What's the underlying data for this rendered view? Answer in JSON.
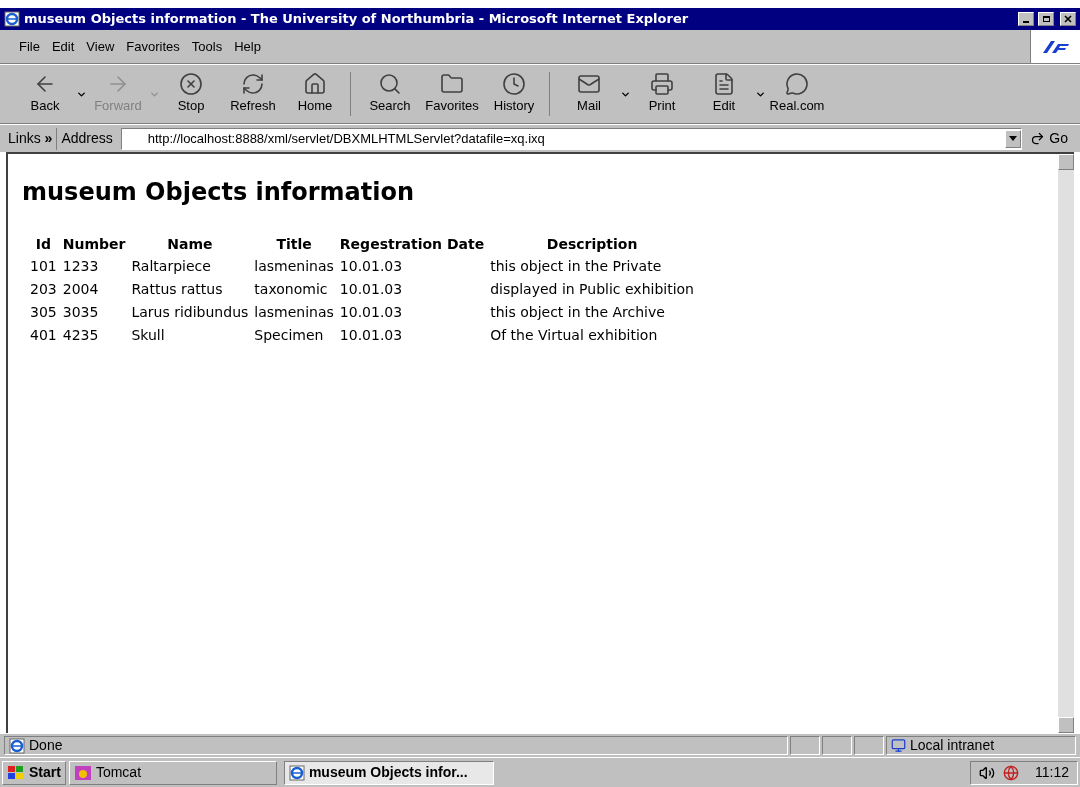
{
  "window": {
    "title": "museum Objects information - The University of Northumbria - Microsoft Internet Explorer"
  },
  "menu": [
    {
      "label": "File"
    },
    {
      "label": "Edit"
    },
    {
      "label": "View"
    },
    {
      "label": "Favorites"
    },
    {
      "label": "Tools"
    },
    {
      "label": "Help"
    }
  ],
  "toolbar": {
    "groups": [
      [
        {
          "label": "Back",
          "disabled": false,
          "dropdown": true
        },
        {
          "label": "Forward",
          "disabled": true,
          "dropdown": true
        },
        {
          "label": "Stop",
          "disabled": false,
          "dropdown": false
        },
        {
          "label": "Refresh",
          "disabled": false,
          "dropdown": false
        },
        {
          "label": "Home",
          "disabled": false,
          "dropdown": false
        }
      ],
      [
        {
          "label": "Search",
          "disabled": false,
          "dropdown": false
        },
        {
          "label": "Favorites",
          "disabled": false,
          "dropdown": false
        },
        {
          "label": "History",
          "disabled": false,
          "dropdown": false
        }
      ],
      [
        {
          "label": "Mail",
          "disabled": false,
          "dropdown": true
        },
        {
          "label": "Print",
          "disabled": false,
          "dropdown": false
        },
        {
          "label": "Edit",
          "disabled": false,
          "dropdown": true
        },
        {
          "label": "Real.com",
          "disabled": false,
          "dropdown": false
        }
      ]
    ]
  },
  "address_bar": {
    "links_label": "Links",
    "chevron": "»",
    "address_label": "Address",
    "url": "http://localhost:8888/xml/servlet/DBXMLHTMLServlet?datafile=xq.ixq",
    "go": "Go"
  },
  "page": {
    "heading": "museum Objects information",
    "table": {
      "columns": [
        "Id",
        "Number",
        "Name",
        "Title",
        "Regestration Date",
        "Description"
      ],
      "rows": [
        [
          "101",
          "1233",
          "Raltarpiece",
          "lasmeninas",
          "10.01.03",
          "this object in the Private"
        ],
        [
          "203",
          "2004",
          "Rattus rattus",
          "taxonomic",
          "10.01.03",
          "displayed in Public exhibition"
        ],
        [
          "305",
          "3035",
          "Larus ridibundus",
          "lasmeninas",
          "10.01.03",
          "this object in the Archive"
        ],
        [
          "401",
          "4235",
          "Skull",
          "Specimen",
          "10.01.03",
          "Of the Virtual exhibition"
        ]
      ]
    }
  },
  "status_bar": {
    "text": "Done",
    "zone": "Local intranet"
  },
  "taskbar": {
    "start": "Start",
    "tasks": [
      {
        "label": "Tomcat",
        "selected": false
      },
      {
        "label": "museum Objects infor...",
        "selected": true
      }
    ],
    "clock": "11:12"
  }
}
